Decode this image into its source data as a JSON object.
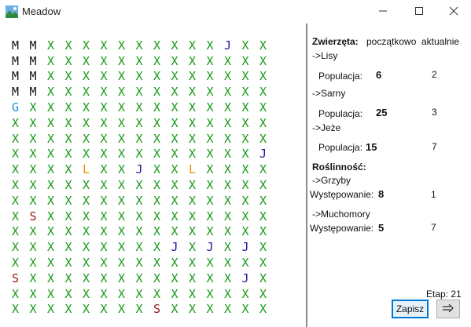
{
  "window": {
    "title": "Meadow"
  },
  "icons": {
    "app": "meadow-app-icon",
    "minimize": "minimize-icon",
    "maximize": "maximize-icon",
    "close": "close-icon",
    "next": "arrow-right-icon"
  },
  "colors": {
    "X": "#1a9a1a",
    "M": "#111111",
    "J": "#1a1aa0",
    "G": "#1e90d8",
    "L": "#f09000",
    "S": "#a01818",
    "accent": "#0078d7"
  },
  "grid": [
    "MMXXXXXXXXXXJXX",
    "MMXXXXXXXXXXXXX",
    "MMXXXXXXXXXXXXX",
    "MMXXXXXXXXXXXXX",
    "GXXXXXXXXXXXXXX",
    "XXXXXXXXXXXXXXX",
    "XXXXXXXXXXXXXXX",
    "XXXXXXXXXXXXXXJ",
    "XXXXLXXJXXLXXXX",
    "XXXXXXXXXXXXXXX",
    "XXXXXXXXXXXXXXX",
    "XSXXXXXXXXXXXXX",
    "XXXXXXXXXXXXXXX",
    "XXXXXXXXXJXJXJX",
    "XXXXXXXXXXXXXXX",
    "SXXXXXXXXXXXXJX",
    "XXXXXXXXXXXXXXX",
    "XXXXXXXXSXXXXXX"
  ],
  "panel": {
    "animals_header": "Zwierzęta:",
    "col_initial": "początkowo",
    "col_current": "aktualnie",
    "lisy_label": "->Lisy",
    "lisy_pop_label": "Populacja:",
    "lisy_initial": "6",
    "lisy_current": "2",
    "sarny_label": "->Sarny",
    "sarny_pop_label": "Populacja:",
    "sarny_initial": "25",
    "sarny_current": "3",
    "jeze_label": "->Jeże",
    "jeze_pop_label": "Populacja:",
    "jeze_initial": "15",
    "jeze_current": "7",
    "plants_header": "Roślinność:",
    "grzyby_label": "->Grzyby",
    "grzyby_occ_label": "Występowanie:",
    "grzyby_initial": "8",
    "grzyby_current": "1",
    "muchomory_label": "->Muchomory",
    "muchomory_occ_label": "Występowanie:",
    "muchomory_initial": "5",
    "muchomory_current": "7",
    "stage": "Etap: 21",
    "save_label": "Zapisz"
  }
}
